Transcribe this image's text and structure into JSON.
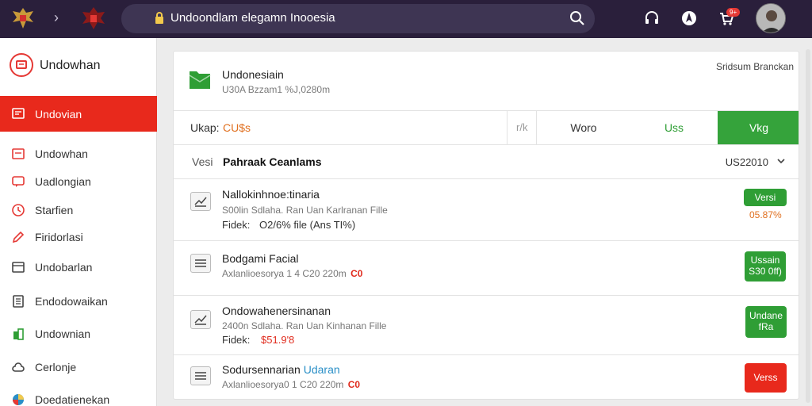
{
  "topbar": {
    "search_text": "Undoondlam elegamn Inooesia",
    "notification_badge": "9+"
  },
  "sidebar": {
    "brand": "Undowhan",
    "active_item": "Undovian",
    "items": [
      {
        "label": "Undowhan",
        "icon": "dashboard-icon"
      },
      {
        "label": "Uadlongian",
        "icon": "chat-icon"
      },
      {
        "label": "Starfien",
        "icon": "clock-icon"
      },
      {
        "label": "Firidorlasi",
        "icon": "pen-icon"
      },
      {
        "label": "Undobarlan",
        "icon": "document-icon"
      },
      {
        "label": "Endodowaikan",
        "icon": "list-icon"
      },
      {
        "label": "Undownian",
        "icon": "building-icon"
      },
      {
        "label": "Cerlonje",
        "icon": "cloud-icon"
      },
      {
        "label": "Doedatienekan",
        "icon": "globe-icon"
      }
    ]
  },
  "header": {
    "title": "Undonesiain",
    "subtitle": "U30A Bzzam1 %J,0280m",
    "right_text": "Sridsum Branckan"
  },
  "tabs": {
    "first_label": "Ukap:",
    "first_value": "CU$s",
    "k_label": "r/k",
    "items": [
      "Woro",
      "Uss",
      "Vkg"
    ],
    "active": "Vkg"
  },
  "filter": {
    "label": "Vesi",
    "value": "Pahraak Ceanlams",
    "right_value": "US22010"
  },
  "rows": [
    {
      "title": "Nallokinhnoe:tinaria",
      "sub": "S00lin Sdlaha. Ran Uan Karlranan Fille",
      "meta_label": "Fidek:",
      "meta_value": "O2/6% file (Ans TI%)",
      "button": "Versi",
      "amount": "05.87%"
    },
    {
      "title": "Bodgami Facial",
      "sub": "Axlanlioesorya 1 4 C20 220m",
      "sub_tag": "C0",
      "button_line1": "Ussain",
      "button_line2": "S30 0ff)"
    },
    {
      "title": "Ondowahenersinanan",
      "sub": "2400n Sdlaha. Ran Uan Kinhanan Fille",
      "meta_label": "Fidek:",
      "meta_value": "$51.9'8",
      "button_line1": "Undane",
      "button_line2": "fRa"
    },
    {
      "title": "Sodursennarian",
      "title_extra": "Udaran",
      "sub": "Axlanlioesorya0 1 C20 220m",
      "sub_tag": "C0",
      "button": "Verss"
    }
  ]
}
